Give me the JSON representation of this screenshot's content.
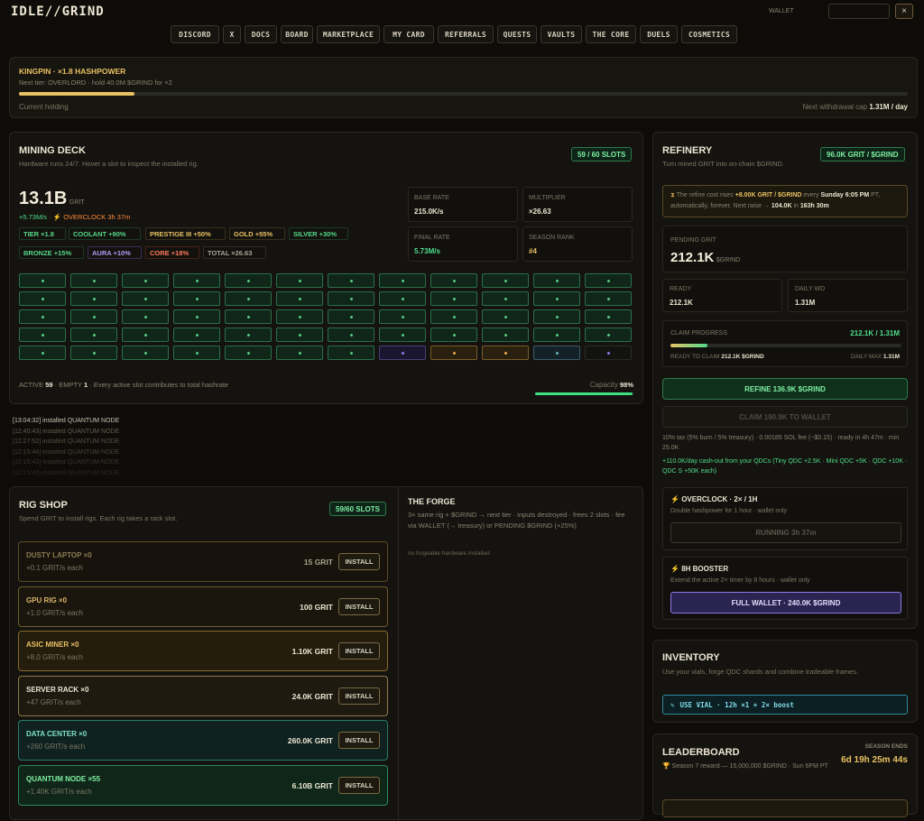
{
  "header": {
    "logo": "IDLE//GRIND",
    "wallet_label": "WALLET",
    "close_icon": "close-icon"
  },
  "nav": [
    "DISCORD",
    "X",
    "DOCS",
    "BOARD",
    "MARKETPLACE",
    "MY CARD",
    "REFERRALS",
    "QUESTS",
    "VAULTS",
    "THE CORE",
    "DUELS",
    "COSMETICS"
  ],
  "tier": {
    "title": "KINGPIN · ×1.8 HASHPOWER",
    "next": "Next tier: OVERLORD · hold 40.0M $GRIND for ×2",
    "holding_label": "Current holding",
    "progress": 0.13,
    "cap_label": "Next withdrawal cap",
    "cap_value": "1.31M / day"
  },
  "mining": {
    "title": "MINING DECK",
    "subtitle": "Hardware runs 24/7. Hover a slot to inspect the installed rig.",
    "slots_badge": "59 / 60 SLOTS",
    "amount": "13.1B",
    "unit": "GRIT",
    "rate": "+5.73M/s",
    "overclock": "OVERCLOCK 3h 37m",
    "chips": [
      "TIER ×1.8",
      "COOLANT +90%",
      "PRESTIGE III +50%",
      "GOLD +55%",
      "SILVER +30%",
      "BRONZE +15%",
      "AURA +10%",
      "CORE +18%",
      "TOTAL ×26.63"
    ],
    "stats": [
      {
        "label": "BASE RATE",
        "value": "215.0K/s"
      },
      {
        "label": "MULTIPLIER",
        "value": "×26.63"
      },
      {
        "label": "FINAL RATE",
        "value": "5.73M/s"
      },
      {
        "label": "SEASON RANK",
        "value": "#4"
      }
    ],
    "footer_active_label": "ACTIVE",
    "footer_active": "59",
    "footer_empty_label": "EMPTY",
    "footer_empty": "1",
    "footer_note": "Every active slot contributes to total hashrate",
    "capacity_label": "Capacity",
    "capacity": "98%",
    "capacity_frac": 0.98
  },
  "log": [
    "[13:04:32] installed QUANTUM NODE",
    "[12:40:43] installed QUANTUM NODE",
    "[12:27:52] installed QUANTUM NODE",
    "[12:15:44] installed QUANTUM NODE",
    "[12:15:43] installed QUANTUM NODE",
    "[12:15:43] installed QUANTUM NODE"
  ],
  "shop": {
    "title": "RIG SHOP",
    "subtitle": "Spend GRIT to install rigs. Each rig takes a rack slot.",
    "badge": "59/60 SLOTS",
    "install": "INSTALL",
    "items": [
      {
        "name": "DUSTY LAPTOP ×0",
        "rate": "+0.1 GRIT/s each",
        "cost": "15 GRIT"
      },
      {
        "name": "GPU RIG ×0",
        "rate": "+1.0 GRIT/s each",
        "cost": "100 GRIT"
      },
      {
        "name": "ASIC MINER ×0",
        "rate": "+8.0 GRIT/s each",
        "cost": "1.10K GRIT"
      },
      {
        "name": "SERVER RACK ×0",
        "rate": "+47 GRIT/s each",
        "cost": "24.0K GRIT"
      },
      {
        "name": "DATA CENTER ×0",
        "rate": "+260 GRIT/s each",
        "cost": "260.0K GRIT"
      },
      {
        "name": "QUANTUM NODE ×55",
        "rate": "+1.40K GRIT/s each",
        "cost": "6.10B GRIT"
      }
    ]
  },
  "forge": {
    "title": "THE FORGE",
    "desc": "3× same rig + $GRIND → next tier · inputs destroyed · frees 2 slots · fee via WALLET (→ treasury) or PENDING $GRIND (+25%)",
    "empty": "no forgeable hardware installed"
  },
  "refinery": {
    "title": "REFINERY",
    "subtitle": "Turn mined GRIT into on-chain $GRIND.",
    "badge": "96.0K GRIT / $GRIND",
    "notice_a": "The refine cost rises",
    "notice_b": "+8.00K GRIT / $GRIND",
    "notice_c": "every",
    "notice_d": "Sunday 6:05 PM",
    "notice_e": "PT, automatically, forever. Next raise →",
    "notice_f": "104.0K",
    "notice_g": "in",
    "notice_h": "163h 30m",
    "pending_label": "PENDING GRIT",
    "pending": "212.1K",
    "pending_unit": "$GRIND",
    "ready_label": "READY",
    "ready": "212.1K",
    "daily_label": "DAILY WD",
    "daily": "1.31M",
    "claim_label": "CLAIM PROGRESS",
    "claim_value": "212.1K / 1.31M",
    "claim_frac": 0.16,
    "ready_claim_label": "READY TO CLAIM",
    "ready_claim": "212.1K $GRIND",
    "daily_max_label": "DAILY MAX",
    "daily_max": "1.31M",
    "refine_btn": "REFINE 136.9K $GRIND",
    "claim_btn": "CLAIM 190.9K TO WALLET",
    "tax_note": "10% tax (5% burn / 5% treasury) · 0.00185 SOL fee (~$0.15) · ready in 4h 47m · min 25.0K",
    "cashout_note": "+110.0K/day cash-out from your QDCs (Tiny QDC +2.5K · Mini QDC +5K · QDC +10K · QDC S +50K each)",
    "overclock_title": "OVERCLOCK · 2× / 1H",
    "overclock_desc": "Double hashpower for 1 hour · wallet only",
    "overclock_btn": "RUNNING 3h 37m",
    "booster_title": "8H BOOSTER",
    "booster_desc": "Extend the active 2× timer by 8 hours · wallet only",
    "booster_btn": "FULL WALLET · 240.0K $GRIND"
  },
  "inventory": {
    "title": "INVENTORY",
    "subtitle": "Use your vials, forge QDC shards and combine tradeable frames.",
    "vial_btn": "USE VIAL · 12h ×1 + 2× boost"
  },
  "leaderboard": {
    "title": "LEADERBOARD",
    "season_label": "SEASON ENDS",
    "countdown": "6d 19h 25m 44s",
    "reward": "Season 7 reward — 15,000,000 $GRIND · Sun 6PM PT"
  },
  "colors": {
    "accent": "#e8c163",
    "green": "#4fdd8a",
    "purple": "#8d7ae6"
  }
}
